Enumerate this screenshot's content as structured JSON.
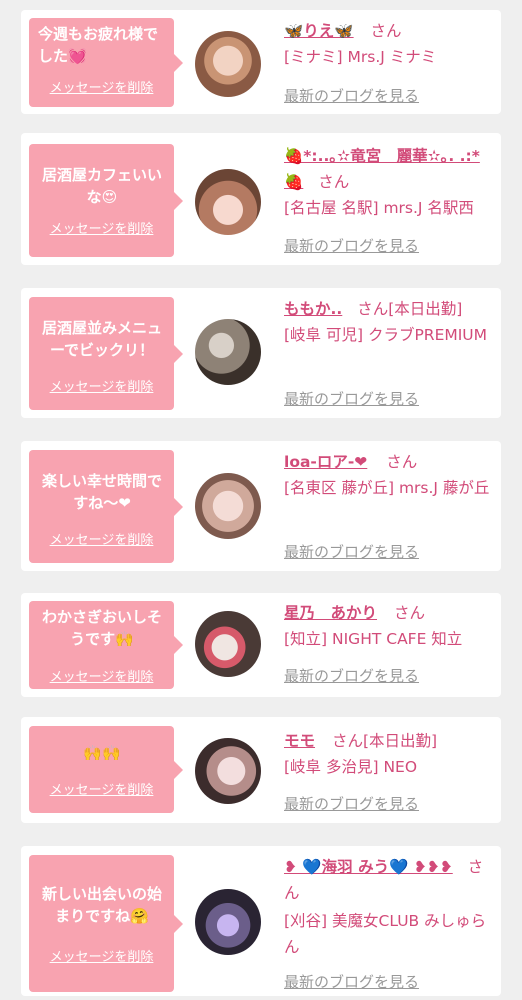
{
  "delete_label": "メッセージを削除",
  "blog_label": "最新のブログを見る",
  "san": "さん",
  "colors": {
    "bubble": "#f8a3b0",
    "accent": "#d24b79",
    "link_gray": "#999999",
    "background": "#efefef"
  },
  "items": [
    {
      "message": "今週もお疲れ様でした💓",
      "name": "🦋りえ🦋",
      "shop": "[ミナミ] Mrs.J ミナミ"
    },
    {
      "message": "居酒屋カフェいいな😍",
      "name": "🍓*:..｡✫竜宮　麗華✫｡. .:*🍓",
      "shop": "[名古屋 名駅] mrs.J 名駅西"
    },
    {
      "message": "居酒屋並みメニューでビックリ！",
      "name": "ももか..",
      "status": "[本日出勤]",
      "shop": "[岐阜 可児] クラブPREMIUM"
    },
    {
      "message": "楽しい幸せ時間ですね〜❤",
      "name": "loa-ロア-❤",
      "shop": "[名東区 藤が丘] mrs.J 藤が丘"
    },
    {
      "message": "わかさぎおいしそうです🙌",
      "name": "星乃　あかり",
      "shop": "[知立] NIGHT CAFE 知立"
    },
    {
      "message": "🙌🙌",
      "name": "モモ",
      "status": "[本日出勤]",
      "shop": "[岐阜 多治見] NEO"
    },
    {
      "message": "新しい出会いの始まりですね🤗",
      "name": "❥ 💙海羽 みう💙 ❥❥❥",
      "shop": "[刈谷] 美魔女CLUB みしゅらん"
    }
  ]
}
